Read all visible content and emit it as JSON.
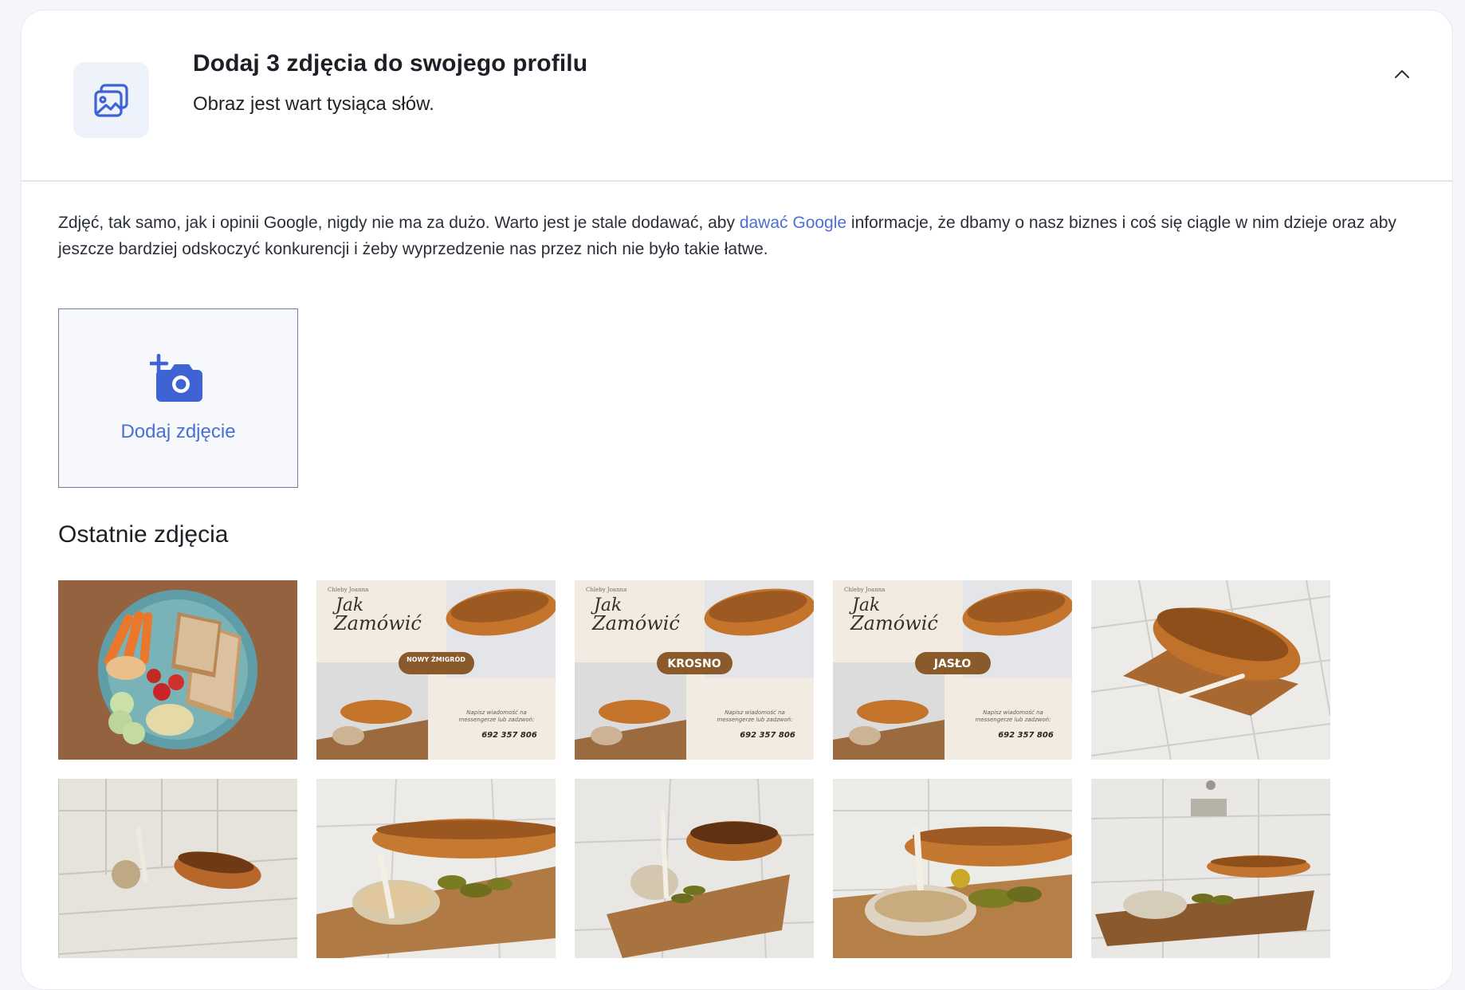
{
  "header": {
    "title": "Dodaj 3 zdjęcia do swojego profilu",
    "subtitle": "Obraz jest wart tysiąca słów.",
    "icon": "gallery-icon",
    "collapse_icon": "chevron-up-icon"
  },
  "description": {
    "before_link": "Zdjęć, tak samo, jak i opinii Google, nigdy nie ma za dużo. Warto jest je stale dodawać, aby ",
    "link": "dawać Google",
    "after_link": " informacje, że dbamy o nasz biznes i coś się ciągle w nim dzieje oraz aby jeszcze bardziej odskoczyć konkurencji i żeby wyprzedzenie nas przez nich nie było takie łatwe."
  },
  "upload": {
    "label": "Dodaj zdjęcie",
    "icon": "add-photo-icon"
  },
  "recent": {
    "title": "Ostatnie zdjęcia"
  },
  "promo": {
    "brand": "Chleby Joanna",
    "heading_line1": "Jak",
    "heading_line2": "Zamówić",
    "note_line1": "Napisz wiadomość na",
    "note_line2": "messengerze lub zadzwoń:",
    "phone": "692 357 806",
    "badges": [
      "NOWY ŻMIGRÓD",
      "KROSNO",
      "JASŁO"
    ]
  },
  "colors": {
    "accent": "#4a6fd6",
    "icon_blue": "#3f63d4",
    "badge_brown": "#8b5a2b"
  }
}
